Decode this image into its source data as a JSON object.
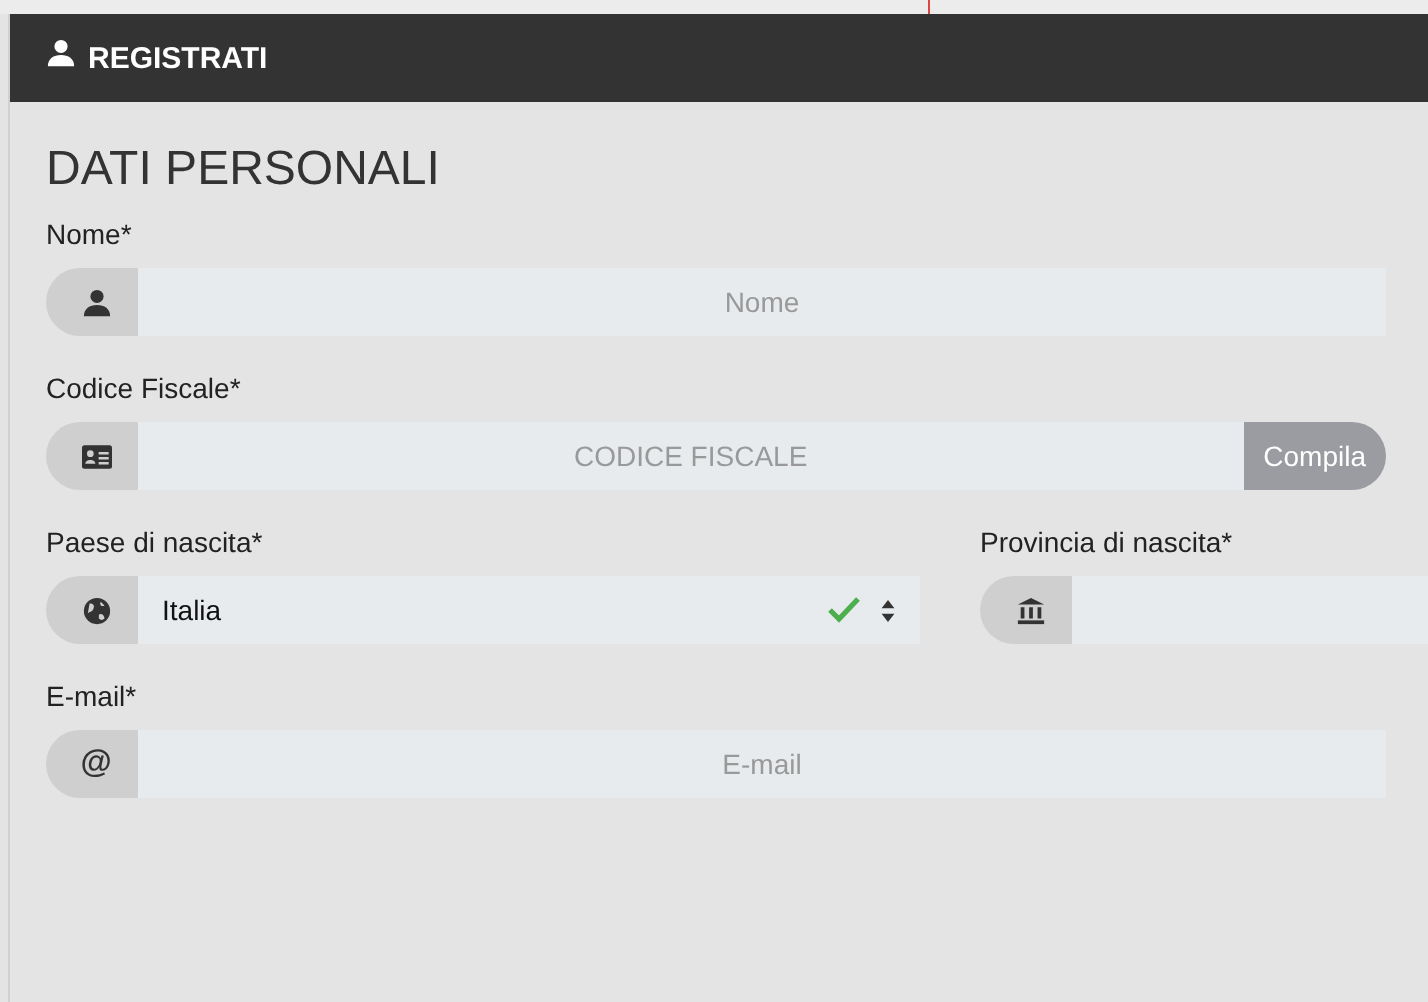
{
  "header": {
    "title": "REGISTRATI"
  },
  "section": {
    "title": "DATI PERSONALI"
  },
  "fields": [
    {
      "kind": "text",
      "label": "Nome*",
      "placeholder": "Nome"
    },
    {
      "kind": "action",
      "label": "Codice Fiscale*",
      "placeholder": "CODICE FISCALE",
      "button": "Compila"
    },
    {
      "kind": "pair",
      "items": [
        {
          "kind": "select",
          "label": "Paese di nascita*",
          "value": "Italia",
          "valid": true
        },
        {
          "kind": "text",
          "label": "Provincia di nascita*"
        }
      ]
    },
    {
      "kind": "text",
      "label": "E-mail*",
      "icon_text": "@",
      "placeholder": "E-mail"
    }
  ]
}
